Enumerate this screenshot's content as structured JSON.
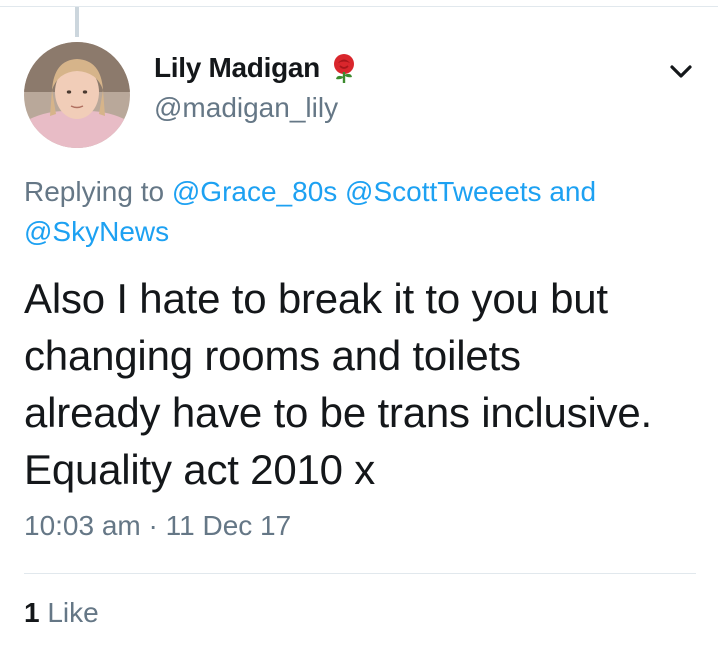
{
  "tweet": {
    "author": {
      "display_name": "Lily Madigan",
      "name_emoji": "rose",
      "handle": "@madigan_lily"
    },
    "reply": {
      "prefix": "Replying to",
      "mentions": [
        "@Grace_80s",
        "@ScottTweeets"
      ],
      "conjunction": "and",
      "last_mention": "@SkyNews"
    },
    "text_lines": [
      "Also I hate to break it to you but",
      "changing rooms and toilets",
      "already have to be trans inclusive.",
      "Equality act 2010 x"
    ],
    "timestamp": "10:03 am · 11 Dec 17",
    "likes": {
      "count": "1",
      "label": "Like"
    }
  },
  "colors": {
    "link": "#1da1f2",
    "secondary": "#657786",
    "primary": "#14171a",
    "divider": "#e1e8ed"
  },
  "icons": {
    "avatar": "profile-photo",
    "menu": "chevron-down-icon",
    "emoji": "rose-icon"
  }
}
